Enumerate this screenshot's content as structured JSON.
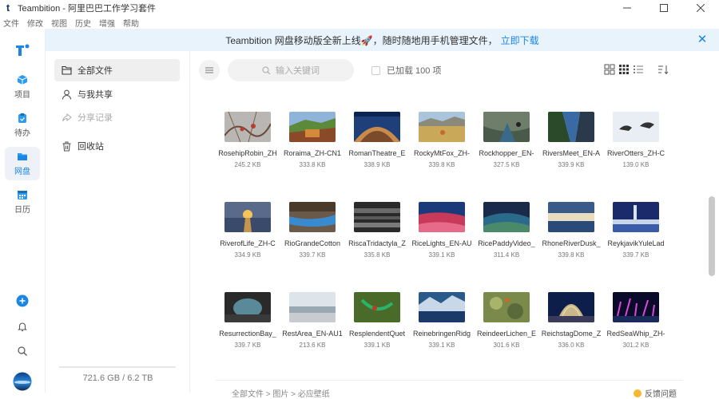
{
  "window": {
    "title": "Teambition - 阿里巴巴工作学习套件"
  },
  "menu": [
    "文件",
    "修改",
    "视图",
    "历史",
    "增强",
    "帮助"
  ],
  "rail": {
    "items": [
      {
        "label": "项目"
      },
      {
        "label": "待办"
      },
      {
        "label": "网盘"
      },
      {
        "label": "日历"
      }
    ]
  },
  "notice": {
    "text": "Teambition 网盘移动版全新上线🚀，随时随地用手机管理文件，",
    "link": "立即下载"
  },
  "nav": {
    "items": [
      {
        "label": "全部文件"
      },
      {
        "label": "与我共享"
      },
      {
        "label": "分享记录"
      },
      {
        "label": "回收站"
      }
    ],
    "storage": "721.6 GB / 6.2 TB"
  },
  "toolbar": {
    "search_placeholder": "输入关键词",
    "loaded": "已加载 100 项"
  },
  "files": [
    {
      "name": "RosehipRobin_ZH",
      "size": "245.2 KB"
    },
    {
      "name": "Roraima_ZH-CN1",
      "size": "333.8 KB"
    },
    {
      "name": "RomanTheatre_E",
      "size": "338.9 KB"
    },
    {
      "name": "RockyMtFox_ZH-",
      "size": "339.8 KB"
    },
    {
      "name": "Rockhopper_EN-",
      "size": "327.5 KB"
    },
    {
      "name": "RiversMeet_EN-A",
      "size": "339.9 KB"
    },
    {
      "name": "RiverOtters_ZH-C",
      "size": "139.0 KB"
    },
    {
      "name": "RiverofLife_ZH-C",
      "size": "334.9 KB"
    },
    {
      "name": "RioGrandeCotton",
      "size": "339.7 KB"
    },
    {
      "name": "RiscaTridactyla_Z",
      "size": "335.8 KB"
    },
    {
      "name": "RiceLights_EN-AU",
      "size": "339.1 KB"
    },
    {
      "name": "RicePaddyVideo_",
      "size": "311.4 KB"
    },
    {
      "name": "RhoneRiverDusk_",
      "size": "339.8 KB"
    },
    {
      "name": "ReykjavikYuleLad",
      "size": "339.7 KB"
    },
    {
      "name": "ResurrectionBay_",
      "size": "339.7 KB"
    },
    {
      "name": "RestArea_EN-AU1",
      "size": "213.6 KB"
    },
    {
      "name": "ResplendentQuet",
      "size": "339.1 KB"
    },
    {
      "name": "ReinebringenRidg",
      "size": "339.1 KB"
    },
    {
      "name": "ReindeerLichen_E",
      "size": "301.6 KB"
    },
    {
      "name": "ReichstagDome_Z",
      "size": "336.0 KB"
    },
    {
      "name": "RedSeaWhip_ZH-",
      "size": "301.2 KB"
    }
  ],
  "breadcrumb": [
    "全部文件",
    "图片",
    "必应壁纸"
  ],
  "feedback": "反馈问题",
  "colors": {
    "accent": "#1b86e3",
    "notice_bg": "#e8f3fc"
  }
}
